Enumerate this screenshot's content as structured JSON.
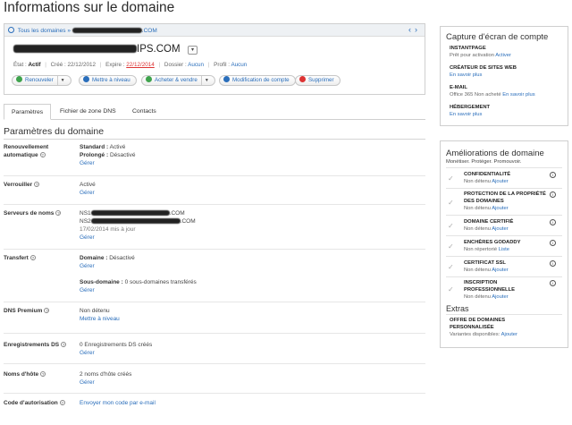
{
  "page": {
    "title": "Informations sur le domaine"
  },
  "header": {
    "breadcrumb_root": "Tous les domaines",
    "breadcrumb_sep": "»",
    "breadcrumb_suffix": ".COM",
    "domain_suffix": "IPS.COM",
    "domain_prefix_partial": "…",
    "nav_prev": "‹",
    "nav_next": "›",
    "dropdown_glyph": "▾",
    "meta": {
      "state_label": "État :",
      "state_value": "Actif",
      "created_label": "Créé :",
      "created_value": "22/12/2012",
      "expires_label": "Expire :",
      "expires_value": "22/12/2014",
      "folder_label": "Dossier :",
      "folder_value": "Aucun",
      "profile_label": "Profil :",
      "profile_value": "Aucun"
    },
    "buttons": {
      "renew": "Renouveler",
      "upgrade": "Mettre à niveau",
      "buy_sell": "Acheter & vendre",
      "edit_account": "Modification de compte",
      "delete": "Supprimer"
    },
    "colors": {
      "expire": "#dd3333",
      "link": "#2a6ebb"
    }
  },
  "tabs": [
    "Paramètres",
    "Fichier de zone DNS",
    "Contacts"
  ],
  "settings": {
    "title": "Paramètres du domaine",
    "renewal": {
      "label_line1": "Renouvellement",
      "label_line2": "automatique",
      "standard_label": "Standard :",
      "standard_value": "Activé",
      "extended_label": "Prolongé :",
      "extended_value": "Désactivé",
      "manage": "Gérer"
    },
    "lock": {
      "label": "Verrouiller",
      "value": "Activé",
      "manage": "Gérer"
    },
    "nameservers": {
      "label": "Serveurs de noms",
      "ns1_prefix": "NS1",
      "ns1_suffix": ".COM",
      "ns2_prefix": "NS2",
      "ns2_suffix": ".COM",
      "updated": "17/02/2014 mis à jour",
      "manage": "Gérer"
    },
    "transfer": {
      "label": "Transfert",
      "domain_label": "Domaine :",
      "domain_value": "Désactivé",
      "manage1": "Gérer",
      "subdomain_label": "Sous-domaine :",
      "subdomain_value": "0 sous-domaines transférés",
      "manage2": "Gérer"
    },
    "dns_premium": {
      "label": "DNS Premium",
      "value": "Non détenu",
      "action": "Mettre à niveau"
    },
    "ds_records": {
      "label": "Enregistrements DS",
      "value": "0 Enregistrements DS créés",
      "manage": "Gérer"
    },
    "hostnames": {
      "label": "Noms d'hôte",
      "value": "2 noms d'hôte créés",
      "manage": "Gérer"
    },
    "auth_code": {
      "label": "Code d'autorisation",
      "action": "Envoyer mon code par e-mail"
    }
  },
  "panel_capture": {
    "title": "Capture d'écran de compte",
    "items": [
      {
        "title": "INSTANTPAGE",
        "status": "Prêt pour activation",
        "action": "Activer"
      },
      {
        "title": "CRÉATEUR DE SITES WEB",
        "status": "",
        "action": "En savoir plus"
      },
      {
        "title": "E-MAIL",
        "status": "Office 365 Non acheté",
        "action": "En savoir plus"
      },
      {
        "title": "HÉBERGEMENT",
        "status": "",
        "action": "En savoir plus"
      }
    ]
  },
  "panel_improve": {
    "title": "Améliorations de domaine",
    "subtitle": "Monétiser. Protéger. Promouvoir.",
    "items": [
      {
        "title": "CONFIDENTIALITÉ",
        "status": "Non détenu",
        "action": "Ajouter"
      },
      {
        "title": "PROTECTION DE LA PROPRIÉTÉ DES DOMAINES",
        "status": "Non détenu",
        "action": "Ajouter"
      },
      {
        "title": "DOMAINE CERTIFIÉ",
        "status": "Non détenu",
        "action": "Ajouter"
      },
      {
        "title": "ENCHÈRES GODADDY",
        "status": "Non répertorié",
        "action": "Liste"
      },
      {
        "title": "CERTIFICAT SSL",
        "status": "Non détenu",
        "action": "Ajouter"
      },
      {
        "title": "INSCRIPTION PROFESSIONNELLE",
        "status": "Non détenu",
        "action": "Ajouter"
      }
    ],
    "extras_title": "Extras",
    "extras": {
      "title": "OFFRE DE DOMAINES PERSONNALISÉE",
      "status": "Variantes disponibles:",
      "action": "Ajouter"
    }
  }
}
